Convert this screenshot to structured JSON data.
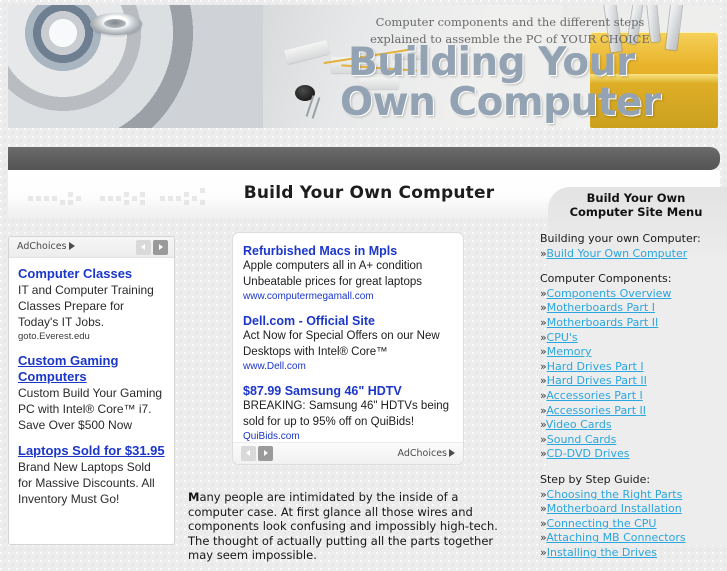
{
  "banner": {
    "subtitle_line1": "Computer components and the different steps",
    "subtitle_line2": "explained to assemble the PC of YOUR CHOICE",
    "title_line1": "Building Your",
    "title_line2": "Own Computer"
  },
  "page": {
    "title": "Build Your Own Computer",
    "body_paragraph_lead": "M",
    "body_paragraph": "any people are intimidated by the inside of a computer case. At first glance all those wires and components look confusing and impossibly high-tech. The thought of actually putting all the parts together may seem impossible."
  },
  "left_ad": {
    "adchoices_label": "AdChoices",
    "prev_label": "Previous ad",
    "next_label": "Next ad",
    "items": [
      {
        "title": "Computer Classes",
        "underlined": false,
        "desc": "IT and Computer Training Classes Prepare for Today's IT Jobs.",
        "url": "goto.Everest.edu"
      },
      {
        "title": "Custom Gaming Computers",
        "underlined": true,
        "desc": "Custom Build Your Gaming PC with Intel® Core™ i7. Save Over $500 Now",
        "url": ""
      },
      {
        "title": "Laptops Sold for $31.95",
        "underlined": true,
        "desc": "Brand New Laptops Sold for Massive Discounts. All Inventory Must Go!",
        "url": ""
      }
    ]
  },
  "center_ad": {
    "adchoices_label": "AdChoices",
    "prev_label": "Previous ad",
    "next_label": "Next ad",
    "items": [
      {
        "title": "Refurbished Macs in Mpls",
        "desc": "Apple computers all in A+ condition Unbeatable prices for great laptops",
        "url": "www.computermegamall.com"
      },
      {
        "title": "Dell.com - Official Site",
        "desc": "Act Now for Special Offers on our New Desktops with Intel® Core™",
        "url": "www.Dell.com"
      },
      {
        "title": "$87.99 Samsung 46\" HDTV",
        "desc": "BREAKING: Samsung 46\" HDTVs being sold for up to 95% off on QuiBids!",
        "url": "QuiBids.com"
      }
    ]
  },
  "sidebar": {
    "heading_line1": "Build Your Own",
    "heading_line2": "Computer Site Menu",
    "bullet": "»",
    "groups": [
      {
        "title": "Building your own Computer:",
        "links": [
          "Build Your Own Computer"
        ]
      },
      {
        "title": "Computer Components:",
        "links": [
          "Components Overview",
          "Motherboards Part I",
          "Motherboards Part II",
          "CPU's",
          "Memory",
          "Hard Drives Part I",
          "Hard Drives Part II",
          "Accessories Part I",
          "Accessories Part II",
          "Video Cards",
          "Sound Cards",
          "CD-DVD Drives"
        ]
      },
      {
        "title": "Step by Step Guide:",
        "links": [
          "Choosing the Right Parts",
          "Motherboard Installation",
          "Connecting the CPU",
          "Attaching MB Connectors",
          "Installing the Drives"
        ]
      }
    ]
  },
  "colors": {
    "link": "#2ba6de",
    "ad_link": "#1b36c9",
    "nav_strip": "#5e5e5e",
    "banner_title": "#93a3b3"
  }
}
